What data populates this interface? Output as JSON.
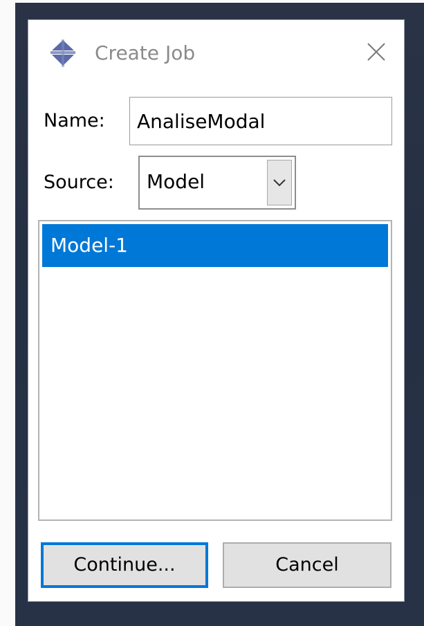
{
  "dialog": {
    "title": "Create Job",
    "app_icon": "abaqus-diamond-icon",
    "close_icon": "close-icon"
  },
  "form": {
    "name_label": "Name:",
    "name_value": "AnaliseModal",
    "source_label": "Source:",
    "source_value": "Model",
    "source_arrow_icon": "chevron-down-icon"
  },
  "list": {
    "items": [
      {
        "label": "Model-1",
        "selected": true
      }
    ]
  },
  "buttons": {
    "continue_label": "Continue...",
    "cancel_label": "Cancel"
  },
  "colors": {
    "selection": "#0078d7",
    "backdrop": "#273247",
    "icon": "#5b6aa8"
  }
}
